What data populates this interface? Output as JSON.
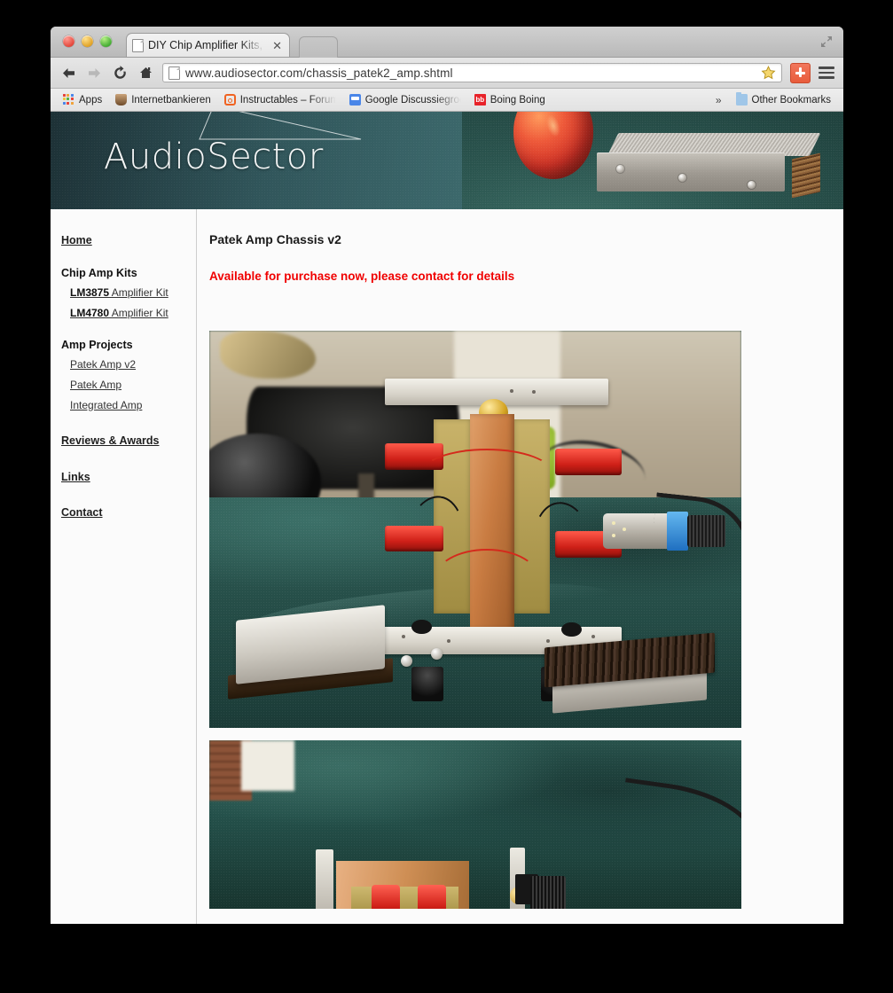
{
  "window": {
    "traffic_lights": [
      "close",
      "minimize",
      "zoom"
    ],
    "fullscreen_icon": "fullscreen-expand-icon"
  },
  "tabs": [
    {
      "title": "DIY Chip Amplifier Kits, PC",
      "favicon": "page-icon",
      "close_label": "✕",
      "active": true
    }
  ],
  "new_tab_label": "",
  "toolbar": {
    "back_icon": "back-arrow-icon",
    "forward_icon": "forward-arrow-icon",
    "reload_icon": "reload-icon",
    "home_icon": "home-icon",
    "url_host": "www.audiosector.com",
    "url_path": "/chassis_patek2_amp.shtml",
    "url_full": "www.audiosector.com/chassis_patek2_amp.shtml",
    "star_icon": "bookmark-star-icon",
    "extension_icon": "plus-extension-icon",
    "menu_icon": "hamburger-menu-icon"
  },
  "bookmarks": {
    "items": [
      {
        "label": "Apps",
        "icon": "apps-grid-icon"
      },
      {
        "label": "Internetbankieren",
        "icon": "bank-icon"
      },
      {
        "label": "Instructables – Forum",
        "icon": "instructables-icon",
        "truncated": true
      },
      {
        "label": "Google Discussiegroepen",
        "icon": "google-groups-icon",
        "truncated": true
      },
      {
        "label": "Boing Boing",
        "icon": "boingboing-icon",
        "icon_text": "bb"
      }
    ],
    "overflow_label": "»",
    "other_bookmarks": {
      "label": "Other Bookmarks",
      "icon": "folder-icon"
    }
  },
  "site": {
    "logo_text": "AudioSector",
    "banner_photo_alt": "apple-and-aluminum-chassis-photo"
  },
  "sidebar": {
    "home": {
      "label": "Home"
    },
    "groups": [
      {
        "title": "Chip Amp Kits",
        "items": [
          {
            "strong": "LM3875",
            "rest": " Amplifier Kit"
          },
          {
            "strong": "LM4780",
            "rest": " Amplifier Kit"
          }
        ]
      },
      {
        "title": "Amp Projects",
        "items": [
          {
            "strong": "",
            "rest": "Patek Amp v2"
          },
          {
            "strong": "",
            "rest": "Patek Amp"
          },
          {
            "strong": "",
            "rest": "Integrated Amp"
          }
        ]
      }
    ],
    "links": [
      {
        "label": "Reviews & Awards"
      },
      {
        "label": "Links"
      },
      {
        "label": "Contact"
      }
    ]
  },
  "main": {
    "title": "Patek Amp Chassis v2",
    "notice": "Available for purchase now, please contact for details",
    "notice_color": "#f00000",
    "photos": [
      {
        "name": "patek-amp-chassis-assembly-photo"
      },
      {
        "name": "patek-amp-chassis-detail-photo"
      }
    ]
  }
}
